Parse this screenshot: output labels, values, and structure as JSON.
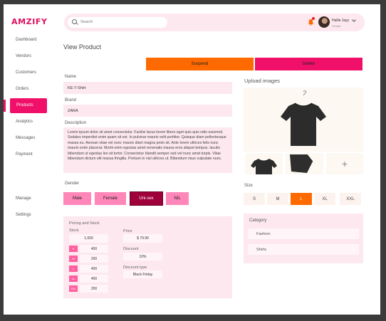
{
  "app": {
    "logo": "AMZIFY"
  },
  "sidebar": {
    "items": [
      {
        "label": "Dashboard"
      },
      {
        "label": "Vendors"
      },
      {
        "label": "Customers"
      },
      {
        "label": "Orders"
      },
      {
        "label": "Products"
      },
      {
        "label": "Analytics"
      },
      {
        "label": "Messages"
      },
      {
        "label": "Payment"
      },
      {
        "label": "Manage"
      },
      {
        "label": "Settings"
      }
    ],
    "active": "Products"
  },
  "header": {
    "search_placeholder": "Search",
    "user": {
      "name": "Hallie Jayy",
      "role": "Vendor"
    }
  },
  "page": {
    "title": "View Product"
  },
  "actions": {
    "suspend": "Suspend",
    "delete": "Delete"
  },
  "form": {
    "name_label": "Name",
    "name_value": "KE-T-Shirt",
    "brand_label": "Brand",
    "brand_value": "ZARA",
    "description_label": "Description",
    "description_value": "Lorem ipsum dolor sit amet consectetur. Facilisi lacus lorem libero eget quis quis odio euismod. Sodales imperdiet enim quam sit est. In pulvinar mauris velit porttitor. Quisque diam pellentesque massa eu. Aenean vitae vel nunc mauris diam magna proin sit. Ante lorem ultrices felis nunc mauris enim placerat. Morbi enim egestas amet venenatis massa eros aliquet tempus. Iaculis bibendum ut egestas leo sit tortor. Consectetur blandit semper sed vel nunc amet turpis. Vitae bibendum dictum elit massa fringilla. Pretium in nisl ultrices ut. Bibendum risus vulputate nunc.",
    "gender_label": "Gender",
    "gender_options": [
      "Male",
      "Female",
      "Uni-sex",
      "NIL"
    ],
    "gender_selected": "Uni-sex"
  },
  "pricing": {
    "title": "Pricing and Stock",
    "stock_label": "Stock",
    "stock_total": "1,000",
    "stock_rows": [
      {
        "size": "S",
        "qty": "400"
      },
      {
        "size": "M",
        "qty": "200"
      },
      {
        "size": "L",
        "qty": "400"
      },
      {
        "size": "XL",
        "qty": "400"
      },
      {
        "size": "XXL",
        "qty": "200"
      }
    ],
    "price_label": "Price",
    "price_value": "$ 79.99",
    "discount_label": "Discount",
    "discount_value": "10%",
    "discount_type_label": "Discount type",
    "discount_type_value": "Black Friday"
  },
  "images": {
    "label": "Upload images",
    "add_symbol": "+"
  },
  "sizes": {
    "label": "Size",
    "options": [
      "S",
      "M",
      "L",
      "XL",
      "XXL"
    ],
    "selected": "L"
  },
  "category": {
    "title": "Category",
    "items": [
      "Fashion",
      "Shirts"
    ]
  },
  "colors": {
    "accent_pink": "#f0106a",
    "accent_orange": "#ff6a00",
    "panel_bg": "#fde8ef"
  }
}
